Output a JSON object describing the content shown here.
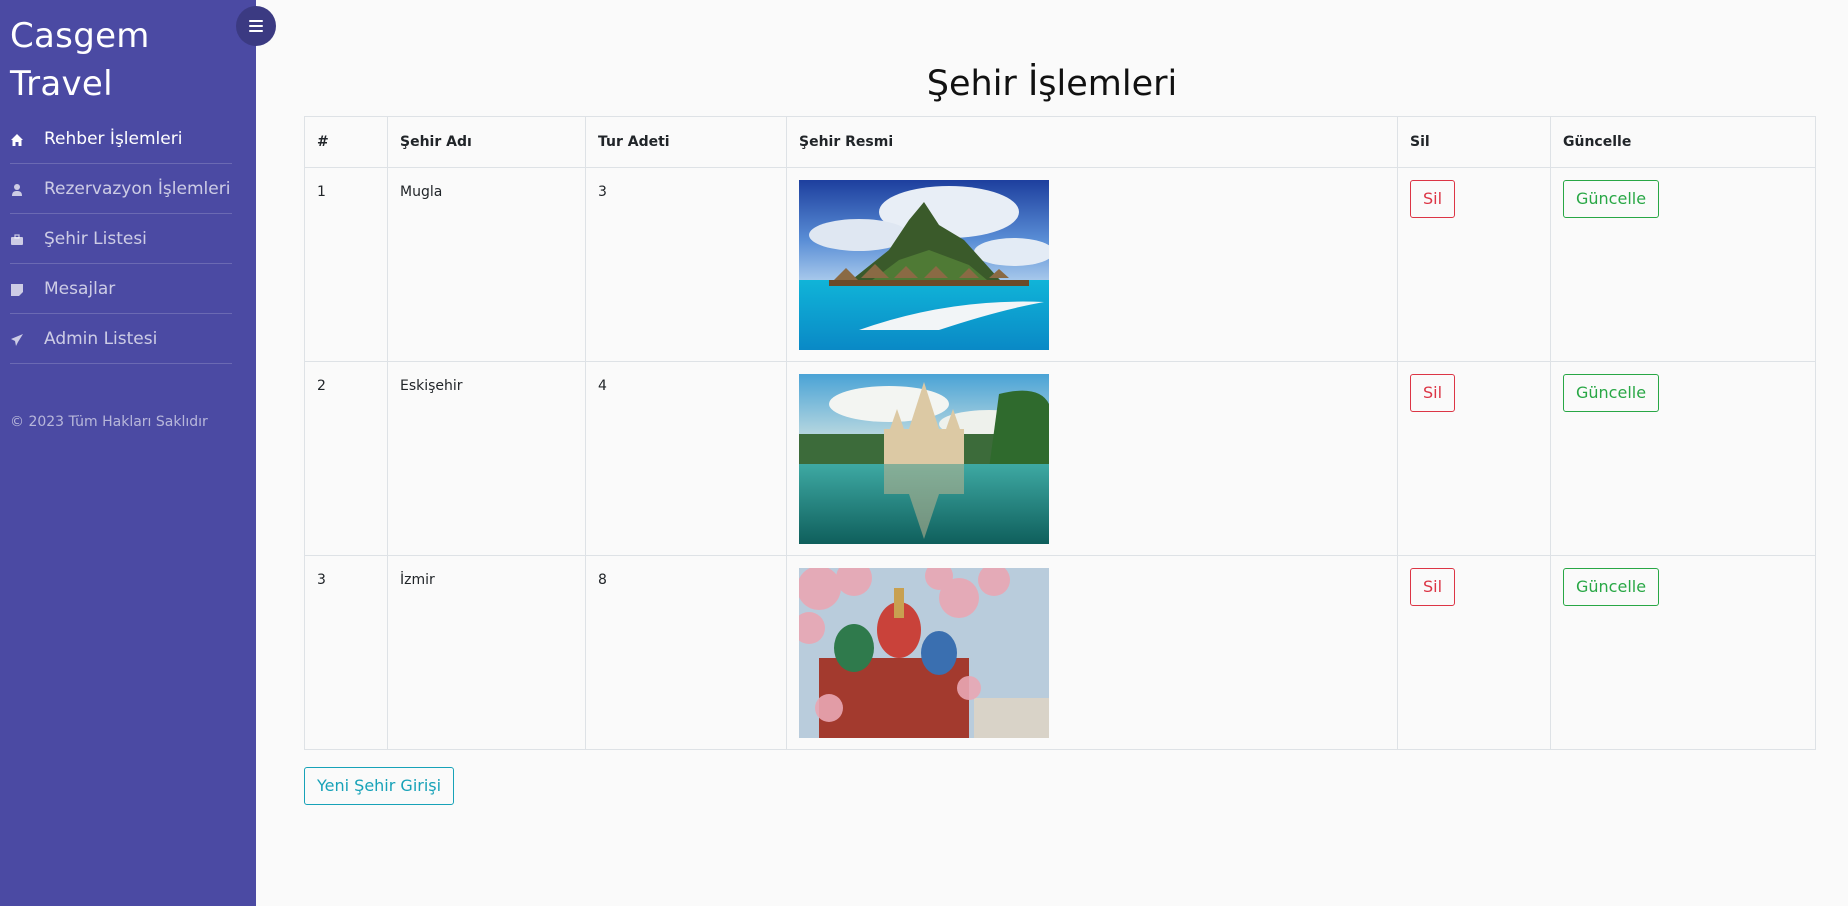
{
  "sidebar": {
    "brand": "Casgem Travel",
    "items": [
      {
        "label": "Rehber İşlemleri",
        "icon": "home-icon",
        "active": true
      },
      {
        "label": "Rezervazyon İşlemleri",
        "icon": "user-icon",
        "active": false
      },
      {
        "label": "Şehir Listesi",
        "icon": "briefcase-icon",
        "active": false
      },
      {
        "label": "Mesajlar",
        "icon": "sticky-note-icon",
        "active": false
      },
      {
        "label": "Admin Listesi",
        "icon": "paper-plane-icon",
        "active": false
      }
    ],
    "footer": "© 2023 Tüm Hakları Saklıdır"
  },
  "page": {
    "title": "Şehir İşlemleri",
    "new_button": "Yeni Şehir Girişi"
  },
  "table": {
    "headers": [
      "#",
      "Şehir Adı",
      "Tur Adeti",
      "Şehir Resmi",
      "Sil",
      "Güncelle"
    ],
    "rows": [
      {
        "id": "1",
        "name": "Mugla",
        "tours": "3",
        "image": "tropical-island-overwater-bungalows",
        "delete": "Sil",
        "update": "Güncelle"
      },
      {
        "id": "2",
        "name": "Eskişehir",
        "tours": "4",
        "image": "temple-reflection-lake",
        "delete": "Sil",
        "update": "Güncelle"
      },
      {
        "id": "3",
        "name": "İzmir",
        "tours": "8",
        "image": "cathedral-cherry-blossoms",
        "delete": "Sil",
        "update": "Güncelle"
      }
    ]
  },
  "colors": {
    "sidebar_bg": "#4b4aa3",
    "danger": "#dc3545",
    "success": "#28a745",
    "info": "#17a2b8"
  }
}
